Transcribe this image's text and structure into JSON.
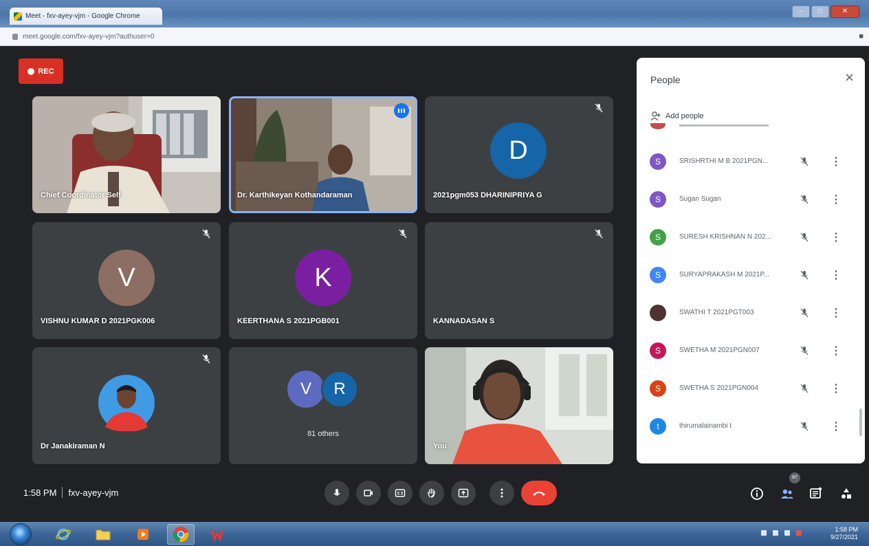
{
  "browser": {
    "tab_title": "Meet - fxv-ayey-vjm - Google Chrome",
    "url": "meet.google.com/fxv-ayey-vjm?authuser=0"
  },
  "recording": {
    "label": "REC"
  },
  "tiles": [
    {
      "name": "Chief Coordinator Self",
      "type": "video"
    },
    {
      "name": "Dr. Karthikeyan Kothandaraman",
      "type": "video",
      "speaking": true
    },
    {
      "name": "2021pgm053 DHARINIPRIYA G",
      "type": "avatar",
      "initial": "D",
      "color": "#1565a8"
    },
    {
      "name": "VISHNU KUMAR D 2021PGK006",
      "type": "avatar",
      "initial": "V",
      "color": "#8d6e63"
    },
    {
      "name": "KEERTHANA S 2021PGB001",
      "type": "avatar",
      "initial": "K",
      "color": "#7b1fa2"
    },
    {
      "name": "KANNADASAN S",
      "type": "blank"
    },
    {
      "name": "Dr Janakiraman N",
      "type": "photo"
    },
    {
      "name": "81 others",
      "type": "others",
      "initials": [
        "V",
        "R"
      ],
      "colors": [
        "#5c6bc0",
        "#1565a8"
      ]
    },
    {
      "name": "You",
      "type": "video"
    }
  ],
  "people_panel": {
    "title": "People",
    "add_people": "Add people",
    "participants": [
      {
        "name": "SRISHRTHI M B 2021PGN...",
        "initial": "S",
        "color": "#7e57c2"
      },
      {
        "name": "Sugan Sugan",
        "initial": "S",
        "color": "#7e57c2"
      },
      {
        "name": "SURESH KRISHNAN N 202...",
        "initial": "S",
        "color": "#43a047"
      },
      {
        "name": "SURYAPRAKASH M 2021P...",
        "initial": "S",
        "color": "#4285f4"
      },
      {
        "name": "SWATHI T 2021PGT003",
        "initial": "",
        "color": "#4e342e"
      },
      {
        "name": "SWETHA M 2021PGN007",
        "initial": "S",
        "color": "#c2185b"
      },
      {
        "name": "SWETHA S 2021PGN004",
        "initial": "S",
        "color": "#d84315"
      },
      {
        "name": "thirumalainambi t",
        "initial": "t",
        "color": "#1e88e5"
      }
    ]
  },
  "meeting": {
    "time": "1:58 PM",
    "code": "fxv-ayey-vjm",
    "participant_count": "87"
  },
  "taskbar": {
    "time": "1:58 PM",
    "date": "9/27/2021"
  },
  "colors": {
    "meet_bg": "#202124",
    "tile_bg": "#3c4043",
    "rec_red": "#d93025",
    "hangup_red": "#ea4335",
    "speaking_blue": "#8ab4f8"
  }
}
